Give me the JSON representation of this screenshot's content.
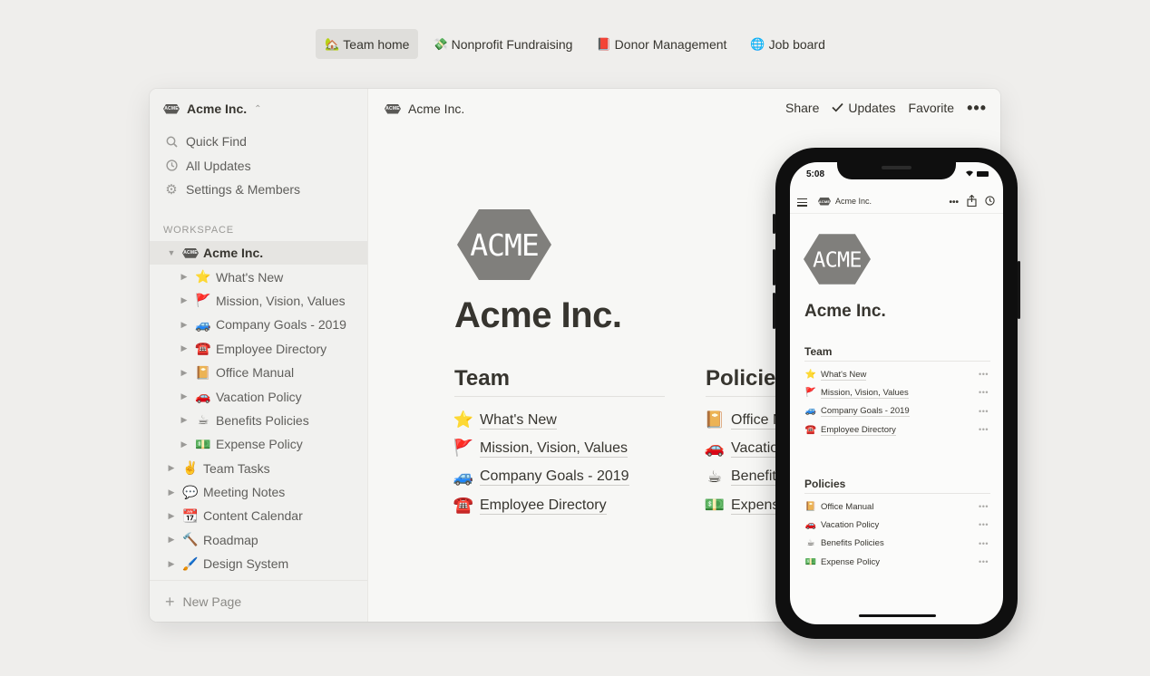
{
  "top_tabs": [
    {
      "emoji": "🏡",
      "label": "Team home",
      "active": true
    },
    {
      "emoji": "💸",
      "label": "Nonprofit Fundraising",
      "active": false
    },
    {
      "emoji": "📕",
      "label": "Donor Management",
      "active": false
    },
    {
      "emoji": "🌐",
      "label": "Job board",
      "active": false
    }
  ],
  "brand": {
    "logo_text": "ACME",
    "logo_color": "#807f7c"
  },
  "sidebar": {
    "workspace_name": "Acme Inc.",
    "nav": [
      {
        "icon": "search-icon",
        "label": "Quick Find"
      },
      {
        "icon": "clock-icon",
        "label": "All Updates"
      },
      {
        "icon": "gear-icon",
        "label": "Settings & Members"
      }
    ],
    "section_label": "WORKSPACE",
    "root": {
      "label": "Acme Inc."
    },
    "children": [
      {
        "emoji": "⭐",
        "label": "What's New"
      },
      {
        "emoji": "🚩",
        "label": "Mission, Vision, Values"
      },
      {
        "emoji": "🚙",
        "label": "Company Goals - 2019"
      },
      {
        "emoji": "☎️",
        "label": "Employee Directory"
      },
      {
        "emoji": "📔",
        "label": "Office Manual"
      },
      {
        "emoji": "🚗",
        "label": "Vacation Policy"
      },
      {
        "emoji": "☕",
        "label": "Benefits Policies"
      },
      {
        "emoji": "💵",
        "label": "Expense Policy"
      }
    ],
    "top_level": [
      {
        "emoji": "✌️",
        "label": "Team Tasks"
      },
      {
        "emoji": "💬",
        "label": "Meeting Notes"
      },
      {
        "emoji": "📆",
        "label": "Content Calendar"
      },
      {
        "emoji": "🔨",
        "label": "Roadmap"
      },
      {
        "emoji": "🖌️",
        "label": "Design System"
      }
    ],
    "new_page_label": "New Page"
  },
  "topbar": {
    "breadcrumb": "Acme Inc.",
    "share": "Share",
    "updates": "Updates",
    "favorite": "Favorite"
  },
  "page": {
    "title": "Acme Inc.",
    "team": {
      "heading": "Team",
      "items": [
        {
          "emoji": "⭐",
          "label": "What's New"
        },
        {
          "emoji": "🚩",
          "label": "Mission, Vision, Values"
        },
        {
          "emoji": "🚙",
          "label": "Company Goals - 2019"
        },
        {
          "emoji": "☎️",
          "label": "Employee Directory"
        }
      ]
    },
    "policies": {
      "heading": "Policies",
      "items": [
        {
          "emoji": "📔",
          "label": "Office Manual"
        },
        {
          "emoji": "🚗",
          "label": "Vacation Policy"
        },
        {
          "emoji": "☕",
          "label": "Benefits Policies"
        },
        {
          "emoji": "💵",
          "label": "Expense Policy"
        }
      ]
    }
  },
  "phone": {
    "time": "5:08",
    "breadcrumb": "Acme Inc.",
    "title": "Acme Inc.",
    "team_heading": "Team",
    "team_items": [
      {
        "emoji": "⭐",
        "label": "What's New"
      },
      {
        "emoji": "🚩",
        "label": "Mission, Vision, Values"
      },
      {
        "emoji": "🚙",
        "label": "Company Goals - 2019"
      },
      {
        "emoji": "☎️",
        "label": "Employee Directory"
      }
    ],
    "policies_heading": "Policies",
    "policy_items": [
      {
        "emoji": "📔",
        "label": "Office Manual"
      },
      {
        "emoji": "🚗",
        "label": "Vacation Policy"
      },
      {
        "emoji": "☕",
        "label": "Benefits Policies"
      },
      {
        "emoji": "💵",
        "label": "Expense Policy"
      }
    ]
  }
}
